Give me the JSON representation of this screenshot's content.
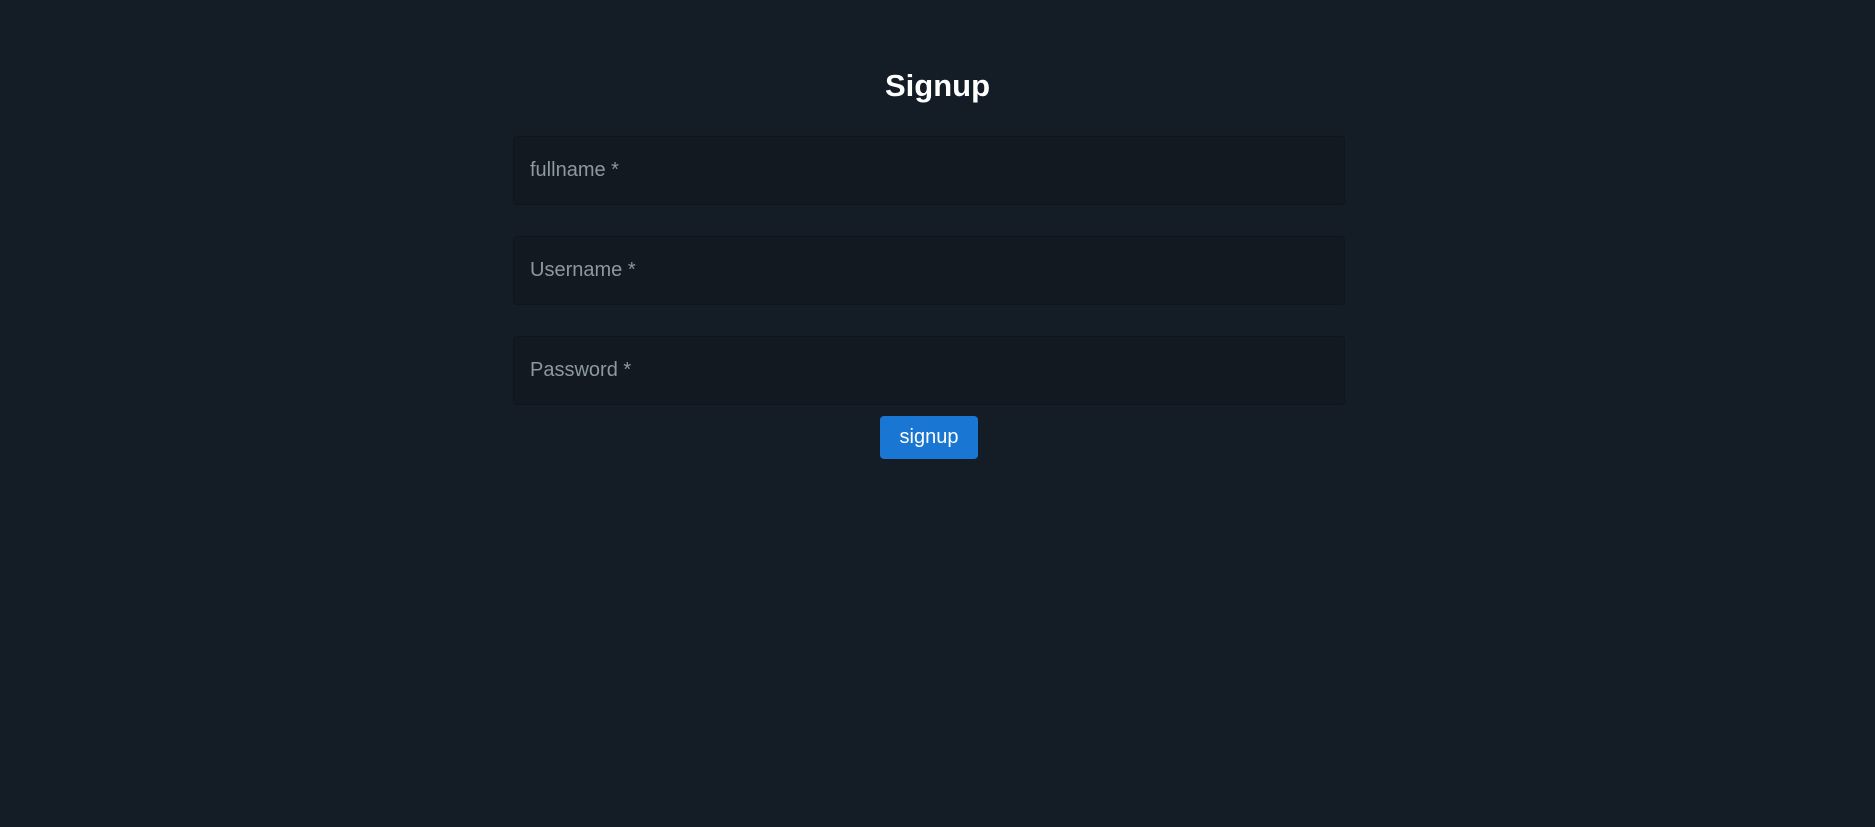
{
  "title": "Signup",
  "form": {
    "fields": [
      {
        "label": "fullname *",
        "value": ""
      },
      {
        "label": "Username *",
        "value": ""
      },
      {
        "label": "Password *",
        "value": ""
      }
    ],
    "submit_label": "signup"
  },
  "colors": {
    "background": "#141c25",
    "field_background": "#121920",
    "label_text": "#8d98a3",
    "title_text": "#ffffff",
    "button_background": "#1976d2",
    "button_text": "#ffffff"
  }
}
